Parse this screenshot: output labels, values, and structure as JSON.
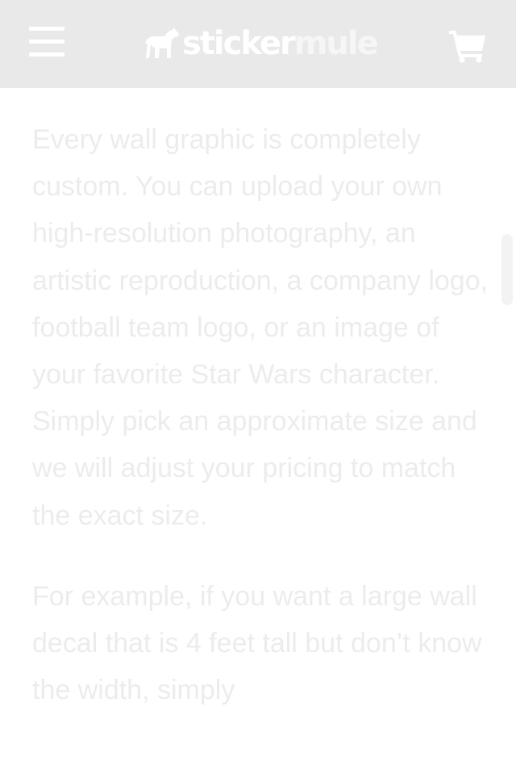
{
  "header": {
    "logo": {
      "word1": "sticker",
      "word2": "mule"
    },
    "menu_icon": "hamburger-icon",
    "cart_icon": "cart-icon"
  },
  "content": {
    "paragraphs": [
      "Every wall graphic is completely custom. You can upload your own high-resolution photography, an artistic reproduction, a company logo, football team logo, or an image of your favorite Star Wars character. Simply pick an approximate size and we will adjust your pricing to match the exact size.",
      "For example, if you want a large wall decal that is 4 feet tall but don’t know the width, simply"
    ]
  },
  "colors": {
    "header_bg": "#e9e9e9",
    "header_icons": "#ffffff",
    "body_text": "#ececec",
    "page_bg": "#ffffff"
  }
}
